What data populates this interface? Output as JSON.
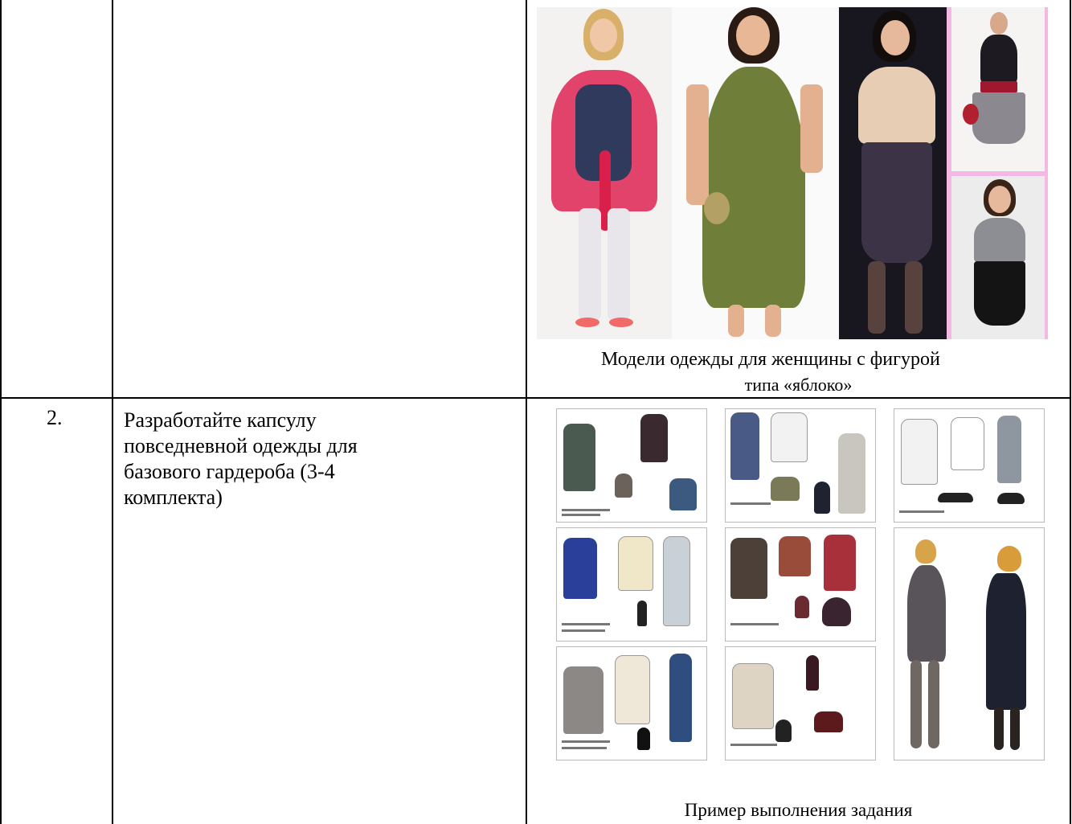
{
  "row2": {
    "number": "2.",
    "task_line1": "Разработайте капсулу",
    "task_line2": "повседневной одежды для",
    "task_line3": "базового гардероба (3-4",
    "task_line4": "комплекта)",
    "caption": "Пример выполнения задания"
  },
  "row1": {
    "caption_line1": "Модели одежды для женщины с фигурой",
    "caption_line2": "типа «яблоко»"
  },
  "colors": {
    "border": "#000000",
    "outfit_green": "#6f7f3a",
    "outfit_pink": "#e2436a",
    "outfit_purple": "#3d3346",
    "collage_pink": "#f4b8e4"
  }
}
